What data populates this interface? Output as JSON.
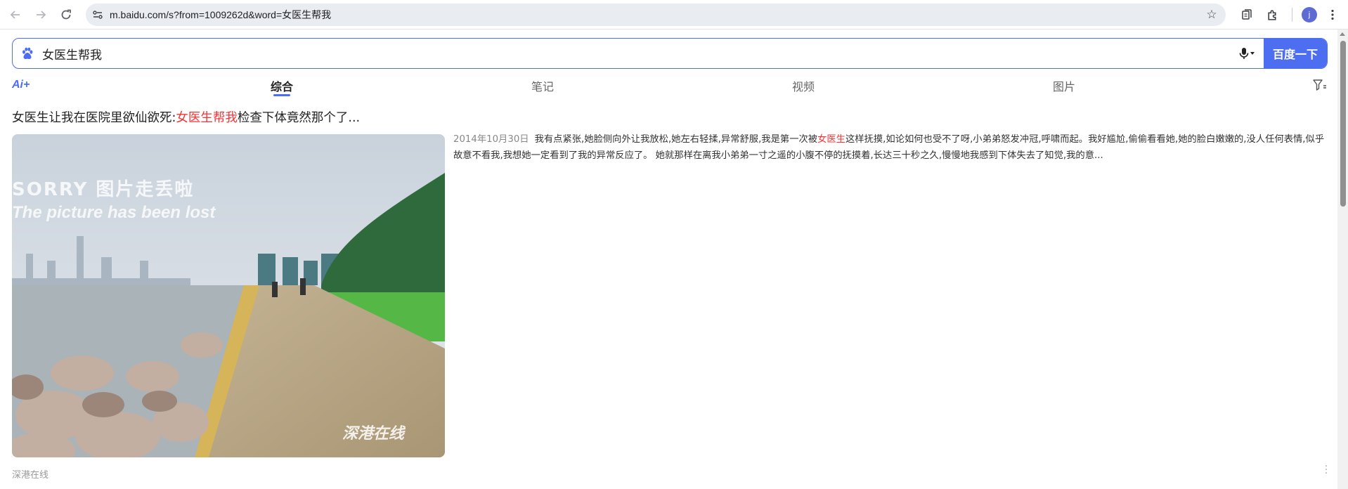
{
  "browser": {
    "url": "m.baidu.com/s?from=1009262d&word=女医生帮我",
    "avatar_letter": "j"
  },
  "search": {
    "query": "女医生帮我",
    "button_label": "百度一下",
    "accent_color": "#4e6ef2"
  },
  "tabs": {
    "ai_label": "Ai+",
    "items": [
      {
        "label": "综合",
        "active": true
      },
      {
        "label": "笔记",
        "active": false
      },
      {
        "label": "视频",
        "active": false
      },
      {
        "label": "图片",
        "active": false
      }
    ]
  },
  "result": {
    "title_pre": "女医生让我在医院里欲仙欲死:",
    "title_highlight": "女医生帮我",
    "title_post": "检查下体竟然那个了...",
    "date": "2014年10月30日",
    "snippet_pre": "我有点紧张,她脸侧向外让我放松,她左右轻揉,异常舒服,我是第一次被",
    "snippet_highlight": "女医生",
    "snippet_post": "这样抚摸,如论如何也受不了呀,小弟弟怒发冲冠,呼啸而起。我好尴尬,偷偷看看她,她的脸白嫩嫩的,没人任何表情,似乎故意不看我,我想她一定看到了我的异常反应了。 她就那样在离我小弟弟一寸之遥的小腹不停的抚摸着,长达三十秒之久,慢慢地我感到下体失去了知觉,我的意...",
    "image": {
      "overlay_line1": "SORRY  图片走丢啦",
      "overlay_line2": "The picture has been lost",
      "watermark": "深港在线"
    },
    "source": "深港在线",
    "highlight_color": "#f73131"
  }
}
